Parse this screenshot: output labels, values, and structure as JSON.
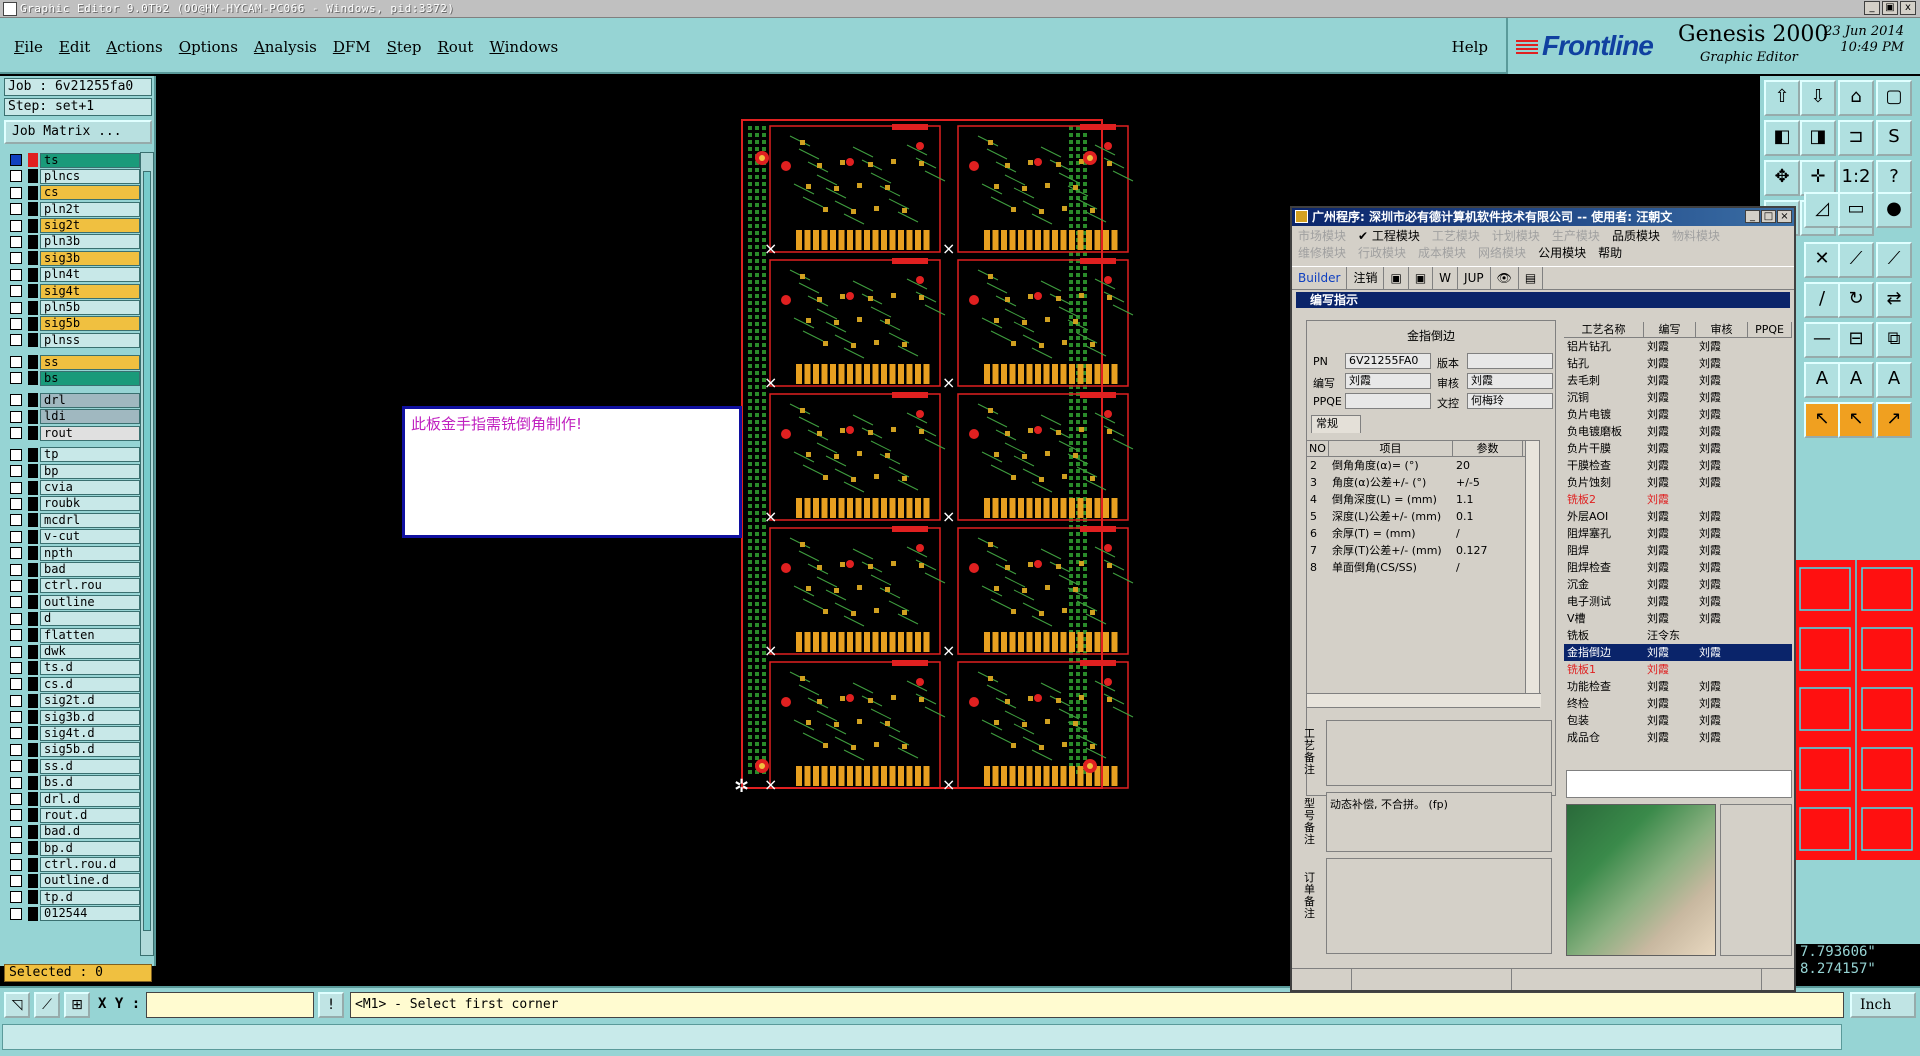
{
  "window": {
    "title": "Graphic Editor 9.0Tb2 (OO@HY-HYCAM-PC066 - Windows, pid:3372)",
    "controls": [
      "_",
      "▣",
      "x"
    ]
  },
  "menu": {
    "items": [
      "File",
      "Edit",
      "Actions",
      "Options",
      "Analysis",
      "DFM",
      "Step",
      "Rout",
      "Windows"
    ],
    "help": "Help"
  },
  "brand": {
    "logo": "Frontline",
    "product": "Genesis 2000",
    "subtitle": "Graphic Editor",
    "date": "23 Jun 2014",
    "time": "10:49 PM"
  },
  "left": {
    "job": "Job : 6v21255fa0",
    "step": "Step: set+1",
    "job_matrix": "Job Matrix ...",
    "selected": "Selected : 0",
    "layers": [
      {
        "name": "ts",
        "color": "#1a9a7a",
        "swatch": "#e02020",
        "active": true
      },
      {
        "name": "plncs",
        "color": "#c8e8e8",
        "swatch": "#000000"
      },
      {
        "name": "cs",
        "color": "#f0c040",
        "swatch": "#000000"
      },
      {
        "name": "pln2t",
        "color": "#c8e8e8",
        "swatch": "#000000"
      },
      {
        "name": "sig2t",
        "color": "#f0c040",
        "swatch": "#000000"
      },
      {
        "name": "pln3b",
        "color": "#c8e8e8",
        "swatch": "#000000"
      },
      {
        "name": "sig3b",
        "color": "#f0c040",
        "swatch": "#000000"
      },
      {
        "name": "pln4t",
        "color": "#c8e8e8",
        "swatch": "#000000"
      },
      {
        "name": "sig4t",
        "color": "#f0c040",
        "swatch": "#000000"
      },
      {
        "name": "pln5b",
        "color": "#c8e8e8",
        "swatch": "#000000"
      },
      {
        "name": "sig5b",
        "color": "#f0c040",
        "swatch": "#000000"
      },
      {
        "name": "plnss",
        "color": "#c8e8e8",
        "swatch": "#000000"
      },
      {
        "sep": true
      },
      {
        "name": "ss",
        "color": "#f0c040",
        "swatch": "#000000"
      },
      {
        "name": "bs",
        "color": "#1a9a7a",
        "swatch": "#000000"
      },
      {
        "sep": true
      },
      {
        "name": "drl",
        "color": "#a0b8c0",
        "swatch": "#000000"
      },
      {
        "name": "ldi",
        "color": "#a0b8c0",
        "swatch": "#000000"
      },
      {
        "name": "rout",
        "color": "#e0e0e0",
        "swatch": "#000000"
      },
      {
        "sep": true
      },
      {
        "name": "tp",
        "color": "#c8e8e8",
        "swatch": "#000000"
      },
      {
        "name": "bp",
        "color": "#c8e8e8",
        "swatch": "#000000"
      },
      {
        "name": "cvia",
        "color": "#c8e8e8",
        "swatch": "#000000"
      },
      {
        "name": "roubk",
        "color": "#c8e8e8",
        "swatch": "#000000"
      },
      {
        "name": "mcdrl",
        "color": "#c8e8e8",
        "swatch": "#000000"
      },
      {
        "name": "v-cut",
        "color": "#c8e8e8",
        "swatch": "#000000"
      },
      {
        "name": "npth",
        "color": "#c8e8e8",
        "swatch": "#000000"
      },
      {
        "name": "bad",
        "color": "#c8e8e8",
        "swatch": "#000000"
      },
      {
        "name": "ctrl.rou",
        "color": "#c8e8e8",
        "swatch": "#000000"
      },
      {
        "name": "outline",
        "color": "#c8e8e8",
        "swatch": "#000000"
      },
      {
        "name": "d",
        "color": "#c8e8e8",
        "swatch": "#000000"
      },
      {
        "name": "flatten",
        "color": "#c8e8e8",
        "swatch": "#000000"
      },
      {
        "name": "dwk",
        "color": "#c8e8e8",
        "swatch": "#000000"
      },
      {
        "name": "ts.d",
        "color": "#c8e8e8",
        "swatch": "#000000"
      },
      {
        "name": "cs.d",
        "color": "#c8e8e8",
        "swatch": "#000000"
      },
      {
        "name": "sig2t.d",
        "color": "#c8e8e8",
        "swatch": "#000000"
      },
      {
        "name": "sig3b.d",
        "color": "#c8e8e8",
        "swatch": "#000000"
      },
      {
        "name": "sig4t.d",
        "color": "#c8e8e8",
        "swatch": "#000000"
      },
      {
        "name": "sig5b.d",
        "color": "#c8e8e8",
        "swatch": "#000000"
      },
      {
        "name": "ss.d",
        "color": "#c8e8e8",
        "swatch": "#000000"
      },
      {
        "name": "bs.d",
        "color": "#c8e8e8",
        "swatch": "#000000"
      },
      {
        "name": "drl.d",
        "color": "#c8e8e8",
        "swatch": "#000000"
      },
      {
        "name": "rout.d",
        "color": "#c8e8e8",
        "swatch": "#000000"
      },
      {
        "name": "bad.d",
        "color": "#c8e8e8",
        "swatch": "#000000"
      },
      {
        "name": "bp.d",
        "color": "#c8e8e8",
        "swatch": "#000000"
      },
      {
        "name": "ctrl.rou.d",
        "color": "#c8e8e8",
        "swatch": "#000000"
      },
      {
        "name": "outline.d",
        "color": "#c8e8e8",
        "swatch": "#000000"
      },
      {
        "name": "tp.d",
        "color": "#c8e8e8",
        "swatch": "#000000"
      },
      {
        "name": "012544",
        "color": "#c8e8e8",
        "swatch": "#000000"
      }
    ]
  },
  "canvas": {
    "note": "此板金手指需铣倒角制作!"
  },
  "status": {
    "xy_label": "X Y :",
    "xy_value": "",
    "prompt": "<M1> - Select first corner",
    "units": "Inch",
    "coord_x": "7.793606\"",
    "coord_y": "8.274157\""
  },
  "cnapp": {
    "title": "广州程序: 深圳市必有德计算机软件技术有限公司 -- 使用者: 汪朝文",
    "modules_row1": [
      {
        "label": "市场模块",
        "on": false
      },
      {
        "label": "✔ 工程模块",
        "on": true
      },
      {
        "label": "工艺模块",
        "on": false
      },
      {
        "label": "计划模块",
        "on": false
      },
      {
        "label": "生产模块",
        "on": false
      },
      {
        "label": "品质模块",
        "on": true
      },
      {
        "label": "物料模块",
        "on": false
      }
    ],
    "modules_row2": [
      {
        "label": "维修模块",
        "on": false
      },
      {
        "label": "行政模块",
        "on": false
      },
      {
        "label": "成本模块",
        "on": false
      },
      {
        "label": "网络模块",
        "on": false
      },
      {
        "label": "公用模块",
        "on": true
      },
      {
        "label": "帮助",
        "on": true
      }
    ],
    "toolbar": [
      "Builder",
      "注销",
      "▣",
      "▣",
      "W",
      "JUP",
      "👁",
      "▤"
    ],
    "subtitle": "编写指示",
    "section_title": "金指倒边",
    "fields": {
      "pn_label": "PN",
      "pn": "6V21255FA0",
      "ver_label": "版本",
      "ver": "",
      "author_label": "编写",
      "author": "刘霞",
      "reviewer_label": "审核",
      "reviewer": "刘霞",
      "ppqe_label": "PPQE",
      "ppqe": "",
      "ctrl_label": "文控",
      "ctrl": "何梅玲"
    },
    "tab": "常规",
    "params_header": [
      "NO",
      "项目",
      "参数"
    ],
    "params": [
      [
        "2",
        "倒角角度(α)=  (°)",
        "20"
      ],
      [
        "3",
        "角度(α)公差+/-  (°)",
        "+/-5"
      ],
      [
        "4",
        "倒角深度(L) =  (mm)",
        "1.1"
      ],
      [
        "5",
        "深度(L)公差+/-  (mm)",
        "0.1"
      ],
      [
        "6",
        "余厚(T) =  (mm)",
        "/"
      ],
      [
        "7",
        "余厚(T)公差+/-  (mm)",
        "0.127"
      ],
      [
        "8",
        "单面倒角(CS/SS)",
        "/"
      ]
    ],
    "process_header": [
      "工艺名称",
      "编写",
      "审核",
      "PPQE"
    ],
    "process": [
      [
        "铝片钻孔",
        "刘霞",
        "刘霞",
        ""
      ],
      [
        "钻孔",
        "刘霞",
        "刘霞",
        ""
      ],
      [
        "去毛刺",
        "刘霞",
        "刘霞",
        ""
      ],
      [
        "沉铜",
        "刘霞",
        "刘霞",
        ""
      ],
      [
        "负片电镀",
        "刘霞",
        "刘霞",
        ""
      ],
      [
        "负电镀磨板",
        "刘霞",
        "刘霞",
        ""
      ],
      [
        "负片干膜",
        "刘霞",
        "刘霞",
        ""
      ],
      [
        "干膜检查",
        "刘霞",
        "刘霞",
        ""
      ],
      [
        "负片蚀刻",
        "刘霞",
        "刘霞",
        ""
      ],
      [
        "铣板2",
        "刘霞",
        "",
        ""
      ],
      [
        "外层AOI",
        "刘霞",
        "刘霞",
        ""
      ],
      [
        "阻焊塞孔",
        "刘霞",
        "刘霞",
        ""
      ],
      [
        "阻焊",
        "刘霞",
        "刘霞",
        ""
      ],
      [
        "阻焊检查",
        "刘霞",
        "刘霞",
        ""
      ],
      [
        "沉金",
        "刘霞",
        "刘霞",
        ""
      ],
      [
        "电子测试",
        "刘霞",
        "刘霞",
        ""
      ],
      [
        "V槽",
        "刘霞",
        "刘霞",
        ""
      ],
      [
        "铣板",
        "汪令东",
        "",
        ""
      ],
      [
        "金指倒边",
        "刘霞",
        "刘霞",
        ""
      ],
      [
        "铣板1",
        "刘霞",
        "",
        ""
      ],
      [
        "功能检查",
        "刘霞",
        "刘霞",
        ""
      ],
      [
        "终检",
        "刘霞",
        "刘霞",
        ""
      ],
      [
        "包装",
        "刘霞",
        "刘霞",
        ""
      ],
      [
        "成品仓",
        "刘霞",
        "刘霞",
        ""
      ]
    ],
    "memo1_label": "工艺备注",
    "memo1": "",
    "memo2_label": "型号备注",
    "memo2": "动态补偿, 不合拼。 (fp)",
    "memo3_label": "订单备注",
    "memo3": ""
  }
}
